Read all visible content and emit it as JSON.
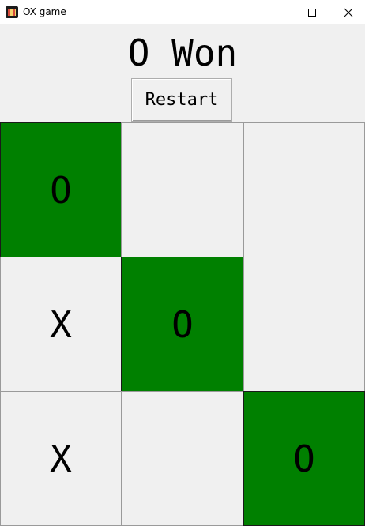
{
  "window": {
    "title": "OX game",
    "icons": {
      "app": "ox-game-icon",
      "minimize": "minimize-icon",
      "maximize": "maximize-icon",
      "close": "close-icon"
    }
  },
  "game": {
    "status": "O Won",
    "restart_label": "Restart",
    "winner": "O",
    "board": [
      [
        "O",
        "",
        ""
      ],
      [
        "X",
        "O",
        ""
      ],
      [
        "X",
        "",
        "O"
      ]
    ],
    "winning_cells": [
      [
        0,
        0
      ],
      [
        1,
        1
      ],
      [
        2,
        2
      ]
    ],
    "colors": {
      "win_highlight": "#008000",
      "cell_default": "#f0f0f0"
    }
  }
}
